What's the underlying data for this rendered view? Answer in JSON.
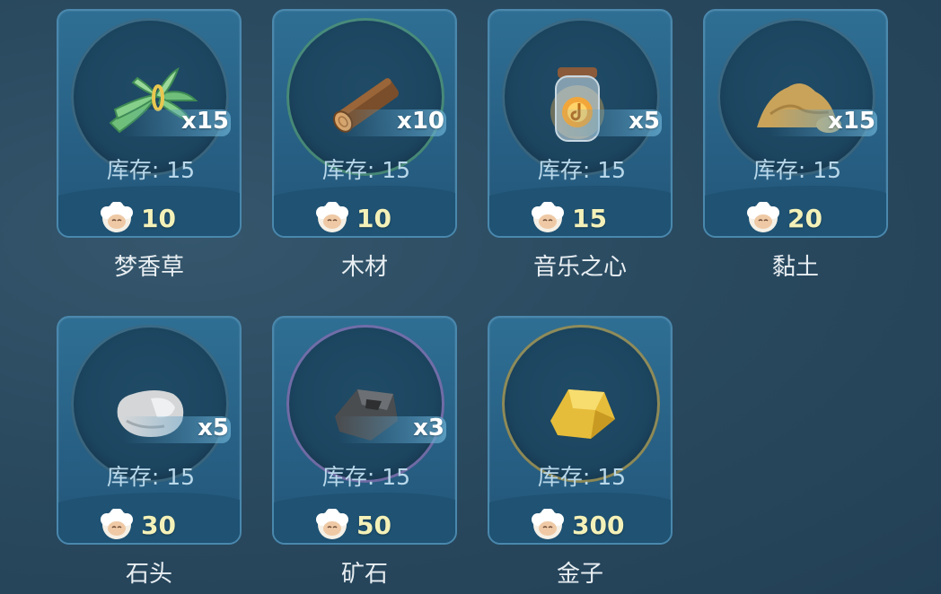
{
  "stock_label": "库存: 15",
  "items": [
    {
      "name": "梦香草",
      "qty": "x15",
      "stock": "库存: 15",
      "price": "10",
      "icon": "grass-bundle-icon"
    },
    {
      "name": "木材",
      "qty": "x10",
      "stock": "库存: 15",
      "price": "10",
      "icon": "wood-log-icon"
    },
    {
      "name": "音乐之心",
      "qty": "x5",
      "stock": "库存: 15",
      "price": "15",
      "icon": "music-heart-jar-icon"
    },
    {
      "name": "黏土",
      "qty": "x15",
      "stock": "库存: 15",
      "price": "20",
      "icon": "clay-pile-icon"
    },
    {
      "name": "石头",
      "qty": "x5",
      "stock": "库存: 15",
      "price": "30",
      "icon": "stone-icon"
    },
    {
      "name": "矿石",
      "qty": "x3",
      "stock": "库存: 15",
      "price": "50",
      "icon": "ore-icon"
    },
    {
      "name": "金子",
      "qty": "",
      "stock": "库存: 15",
      "price": "300",
      "icon": "gold-nugget-icon"
    }
  ],
  "colors": {
    "price": "#f4f1b8",
    "stock": "#b9d8ea",
    "card": "#2f6f94"
  }
}
